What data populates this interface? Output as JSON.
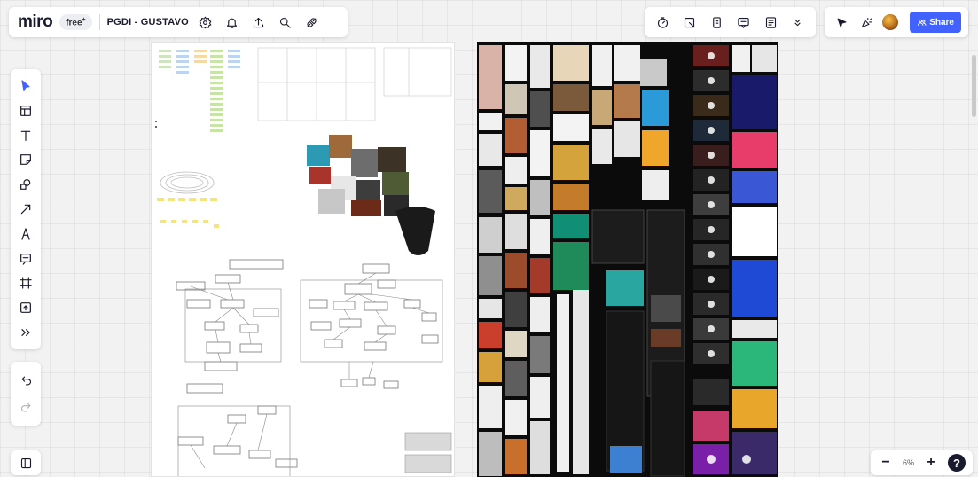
{
  "app": {
    "logo": "miro",
    "plan": "free",
    "board_title": "PGDI - GUSTAVO"
  },
  "top_left_icons": [
    "settings-icon",
    "bell-icon",
    "upload-icon",
    "search-icon",
    "plug-icon"
  ],
  "top_tools_icons": [
    "timer-icon",
    "card-icon",
    "voting-icon",
    "comment-icon",
    "notes-icon",
    "more-chevron-icon"
  ],
  "collab": {
    "share_label": "Share",
    "icons": [
      "reactions-icon",
      "celebrate-icon"
    ]
  },
  "left_tools": [
    "select-icon",
    "templates-icon",
    "text-icon",
    "sticky-note-icon",
    "shapes-icon",
    "arrow-icon",
    "pen-icon",
    "comment-tool-icon",
    "frame-icon",
    "upload-tool-icon",
    "more-tools-icon"
  ],
  "zoom": {
    "value": "6%",
    "minus": "−",
    "plus": "+",
    "help": "?"
  },
  "colors": {
    "accent": "#4262ff",
    "canvas": "#f2f2f2",
    "dark_frame": "#0b0b0b"
  }
}
